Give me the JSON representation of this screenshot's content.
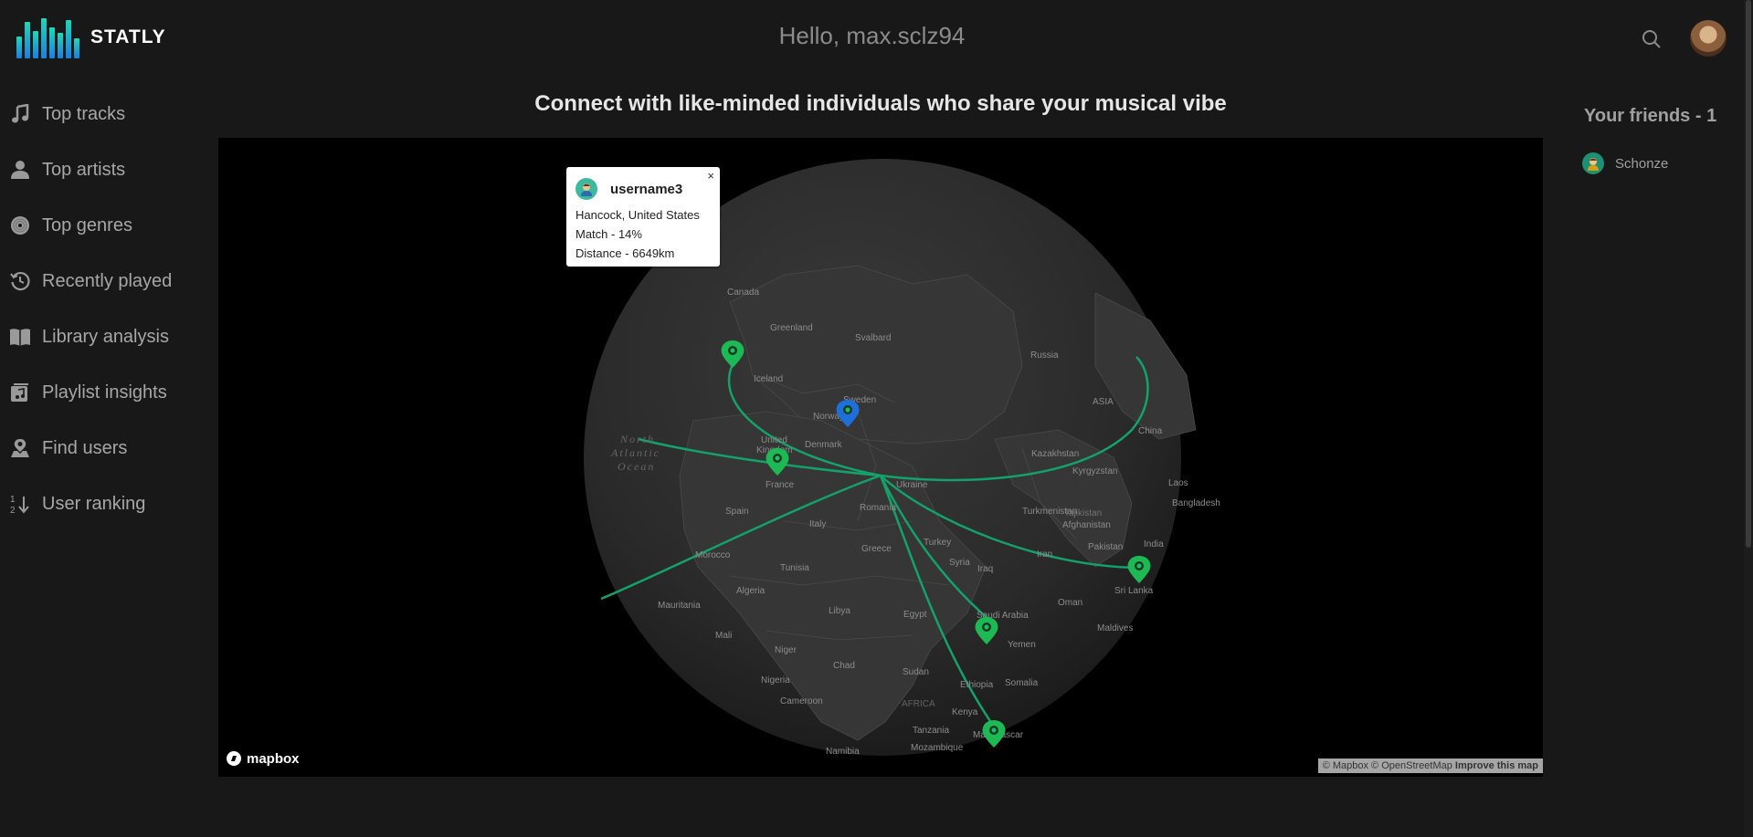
{
  "app": {
    "name": "STATLY"
  },
  "header": {
    "greeting": "Hello, max.sclz94"
  },
  "sidebar": {
    "items": [
      {
        "label": "Top tracks",
        "icon": "music-note-icon"
      },
      {
        "label": "Top artists",
        "icon": "person-icon"
      },
      {
        "label": "Top genres",
        "icon": "vinyl-icon"
      },
      {
        "label": "Recently played",
        "icon": "history-icon"
      },
      {
        "label": "Library analysis",
        "icon": "book-icon"
      },
      {
        "label": "Playlist insights",
        "icon": "playlist-icon"
      },
      {
        "label": "Find users",
        "icon": "user-location-icon"
      },
      {
        "label": "User ranking",
        "icon": "sort-numeric-icon"
      }
    ]
  },
  "main": {
    "title": "Connect with like-minded individuals who share your musical vibe"
  },
  "popup": {
    "username": "username3",
    "location": "Hancock, United States",
    "match": "Match - 14%",
    "distance": "Distance - 6649km",
    "close": "×"
  },
  "map": {
    "brand": "mapbox",
    "attribution": "© Mapbox © OpenStreetMap",
    "improve": "Improve this map",
    "ocean": [
      "North",
      "Atlantic",
      "Ocean"
    ],
    "labels": {
      "canada": "Canada",
      "greenland": "Greenland",
      "svalbard": "Svalbard",
      "russia": "Russia",
      "iceland": "Iceland",
      "sweden": "Sweden",
      "norway": "Norway",
      "asia": "ASIA",
      "united": "United",
      "kingdom": "Kingdom",
      "denmark": "Denmark",
      "china": "China",
      "kazakhstan": "Kazakhstan",
      "kyrgyzstan": "Kyrgyzstan",
      "laos": "Laos",
      "france": "France",
      "ukraine": "Ukraine",
      "poland": "Poland",
      "romania": "Romania",
      "spain": "Spain",
      "italy": "Italy",
      "turkmenistan": "Turkmenistan",
      "bangladesh": "Bangladesh",
      "tajikistan": "Tajikistan",
      "afghanistan": "Afghanistan",
      "turkey": "Turkey",
      "india": "India",
      "greece": "Greece",
      "pakistan": "Pakistan",
      "iran": "Iran",
      "morocco": "Morocco",
      "tunisia": "Tunisia",
      "syria": "Syria",
      "iraq": "Iraq",
      "srilanka": "Sri Lanka",
      "algeria": "Algeria",
      "oman": "Oman",
      "mauritania": "Mauritania",
      "libya": "Libya",
      "egypt": "Egypt",
      "saudi": "Saudi Arabia",
      "maldives": "Maldives",
      "yemen": "Yemen",
      "mali": "Mali",
      "niger": "Niger",
      "chad": "Chad",
      "sudan": "Sudan",
      "nigeria": "Nigeria",
      "ethiopia": "Ethiopia",
      "somalia": "Somalia",
      "cameroon": "Cameroon",
      "africa": "AFRICA",
      "kenya": "Kenya",
      "tanzania": "Tanzania",
      "madagascar": "Madagascar",
      "mozambique": "Mozambique",
      "namibia": "Namibia"
    }
  },
  "friends": {
    "title": "Your friends - 1",
    "list": [
      {
        "name": "Schonze"
      }
    ]
  },
  "colors": {
    "accent": "#1db954",
    "route": "#13a26b",
    "userPin": "#1e6fd9",
    "background": "#181818"
  }
}
